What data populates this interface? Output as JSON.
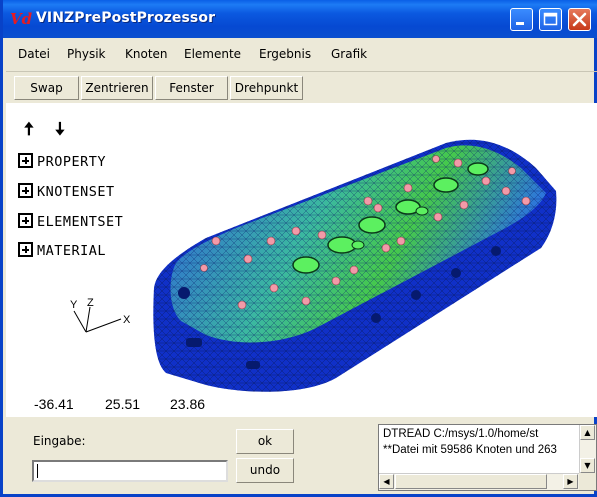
{
  "window": {
    "app_icon": "Vd",
    "title": "VINZPrePostProzessor",
    "controls": [
      "minimize-icon",
      "maximize-icon",
      "close-icon"
    ]
  },
  "menu": [
    "Datei",
    "Physik",
    "Knoten",
    "Elemente",
    "Ergebnis",
    "Grafik"
  ],
  "toolbar": [
    "Swap",
    "Zentrieren",
    "Fenster",
    "Drehpunkt"
  ],
  "viewport": {
    "nav_arrows": {
      "up": "🠅",
      "down": "🠇"
    },
    "tree": [
      "PROPERTY",
      "KNOTENSET",
      "ELEMENTSET",
      "MATERIAL"
    ],
    "axes": {
      "y": "Y",
      "z": "Z",
      "x": "X"
    },
    "coordinates": [
      "-36.41",
      "25.51",
      "23.86"
    ]
  },
  "bottom": {
    "input_label": "Eingabe:",
    "input_value": "",
    "ok_label": "ok",
    "undo_label": "undo",
    "console": [
      "DTREAD C:/msys/1.0/home/st",
      "**Datei mit 59586 Knoten und 263"
    ]
  },
  "colors": {
    "titlebar": "#0b59e0",
    "mesh_dark_blue": "#1030c8",
    "mesh_light_blue": "#2f6ef0",
    "mesh_green": "#33d04a",
    "mesh_pink": "#f29aa8"
  }
}
